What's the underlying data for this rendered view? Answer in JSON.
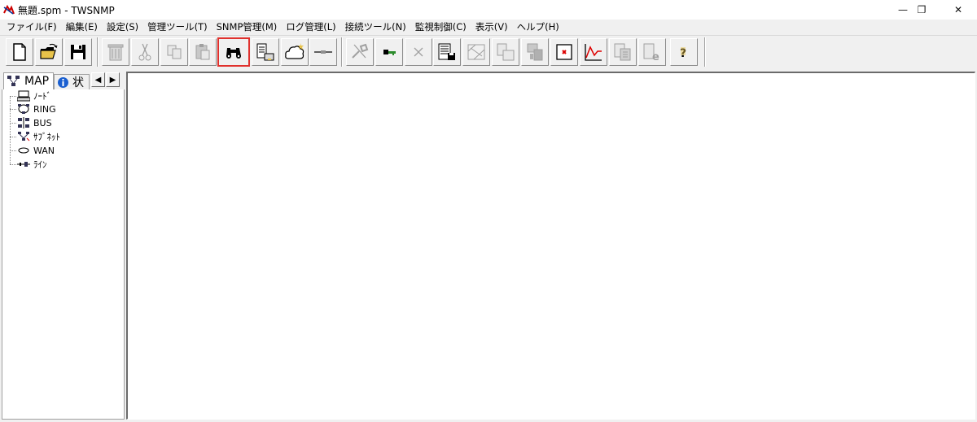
{
  "window": {
    "title": "無題.spm - TWSNMP",
    "minimize_glyph": "—",
    "maximize_glyph": "❐",
    "close_glyph": "✕"
  },
  "menu": [
    "ファイル(F)",
    "編集(E)",
    "設定(S)",
    "管理ツール(T)",
    "SNMP管理(M)",
    "ログ管理(L)",
    "接続ツール(N)",
    "監視制御(C)",
    "表示(V)",
    "ヘルプ(H)"
  ],
  "toolbar": {
    "buttons": [
      {
        "icon": "new-file-icon"
      },
      {
        "icon": "open-folder-icon"
      },
      {
        "icon": "save-disk-icon"
      },
      {
        "icon": "trash-icon",
        "disabled": true
      },
      {
        "icon": "cut-scissors-icon",
        "disabled": true
      },
      {
        "icon": "copy-icon",
        "disabled": true
      },
      {
        "icon": "paste-icon",
        "disabled": true
      },
      {
        "icon": "binoculars-find-icon",
        "highlighted": true
      },
      {
        "icon": "node-list-icon"
      },
      {
        "icon": "cloud-network-icon"
      },
      {
        "icon": "line-connect-icon"
      },
      {
        "icon": "tools-icon",
        "disabled": true
      },
      {
        "icon": "key-icon"
      },
      {
        "icon": "delete-x-icon",
        "disabled": true
      },
      {
        "icon": "log-save-icon"
      },
      {
        "icon": "map-icon",
        "disabled": true
      },
      {
        "icon": "device-icon",
        "disabled": true
      },
      {
        "icon": "server-icon",
        "disabled": true
      },
      {
        "icon": "stop-window-icon"
      },
      {
        "icon": "line-chart-icon"
      },
      {
        "icon": "report-icon",
        "disabled": true
      },
      {
        "icon": "web-icon",
        "disabled": true
      },
      {
        "icon": "help-question-icon"
      }
    ]
  },
  "tabs": {
    "map_label": "MAP",
    "status_label": "状",
    "arrow_left": "◀",
    "arrow_right": "▶"
  },
  "tree": [
    {
      "label": "ﾉｰﾄﾞ",
      "icon": "node-icon"
    },
    {
      "label": "RING",
      "icon": "ring-icon"
    },
    {
      "label": "BUS",
      "icon": "bus-icon"
    },
    {
      "label": "ｻﾌﾞﾈｯﾄ",
      "icon": "subnet-icon"
    },
    {
      "label": "WAN",
      "icon": "wan-icon"
    },
    {
      "label": "ﾗｲﾝ",
      "icon": "line-icon"
    }
  ],
  "colors": {
    "highlight": "#e0312d",
    "window_bg": "#f0f0f0",
    "canvas_bg": "#ffffff"
  }
}
